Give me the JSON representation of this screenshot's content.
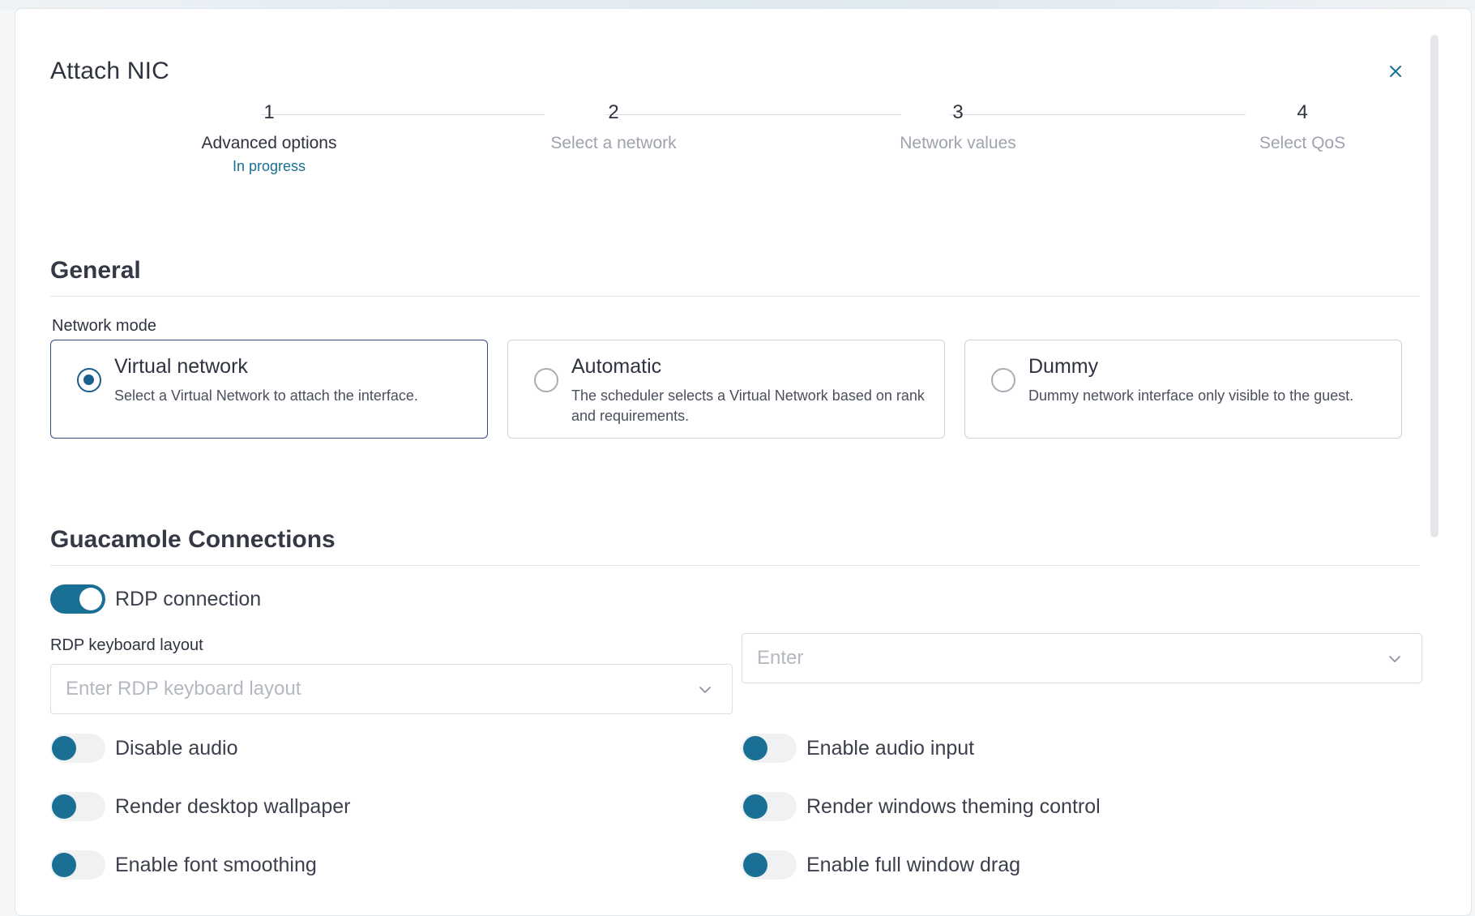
{
  "modal": {
    "title": "Attach NIC",
    "close_label": "×"
  },
  "stepper": {
    "steps": [
      {
        "number": "1",
        "title": "Advanced options",
        "status": "In progress"
      },
      {
        "number": "2",
        "title": "Select a network",
        "status": ""
      },
      {
        "number": "3",
        "title": "Network values",
        "status": ""
      },
      {
        "number": "4",
        "title": "Select QoS",
        "status": ""
      }
    ]
  },
  "general": {
    "title": "General",
    "network_mode_label": "Network mode",
    "options": [
      {
        "title": "Virtual network",
        "description": "Select a Virtual Network to attach the interface.",
        "selected": true
      },
      {
        "title": "Automatic",
        "description": "The scheduler selects a Virtual Network based on rank and requirements.",
        "selected": false
      },
      {
        "title": "Dummy",
        "description": "Dummy network interface only visible to the guest.",
        "selected": false
      }
    ]
  },
  "guacamole": {
    "title": "Guacamole Connections",
    "rdp_connection_label": "RDP connection",
    "rdp_keyboard_layout_label": "RDP keyboard layout",
    "rdp_keyboard_layout_placeholder": "Enter RDP keyboard layout",
    "second_select_placeholder": "Enter",
    "toggles_left": [
      {
        "label": "Disable audio"
      },
      {
        "label": "Render desktop wallpaper"
      },
      {
        "label": "Enable font smoothing"
      }
    ],
    "toggles_right": [
      {
        "label": "Enable audio input"
      },
      {
        "label": "Render windows theming control"
      },
      {
        "label": "Enable full window drag"
      }
    ]
  }
}
